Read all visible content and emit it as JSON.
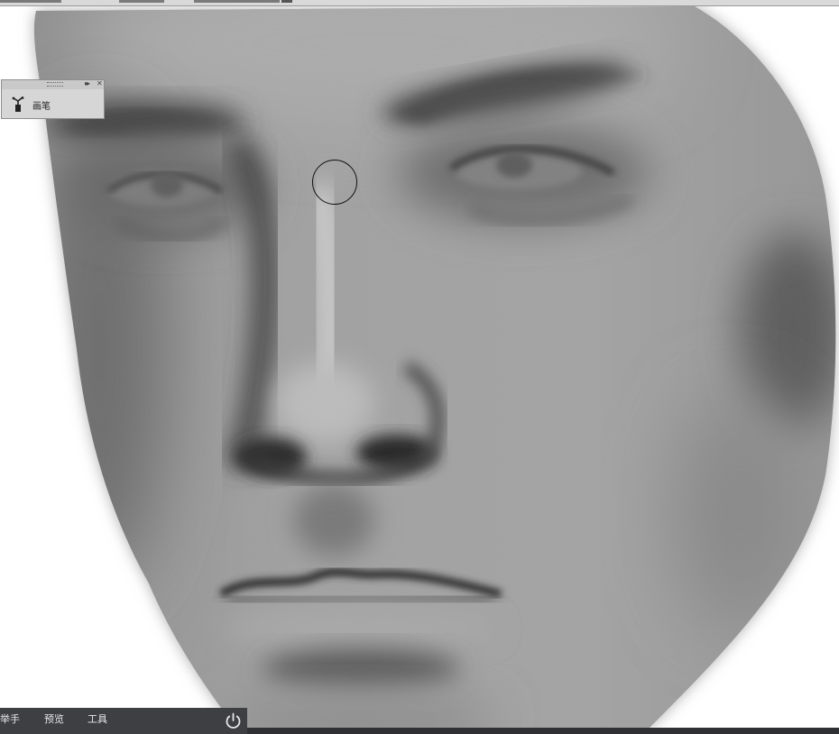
{
  "panel": {
    "tool_label": "画笔",
    "tool_icon": "brush-icon",
    "collapse_icon": "double-arrow-icon",
    "close_icon": "close-icon"
  },
  "bottom_bar": {
    "items": [
      {
        "label": "举手"
      },
      {
        "label": "预览"
      },
      {
        "label": "工具"
      }
    ],
    "power_icon": "power-icon"
  },
  "canvas": {
    "subject": "grayscale digital painting of a face",
    "brush_cursor": "circle-brush-cursor"
  },
  "colors": {
    "panel_bg": "#d6d6d6",
    "bottom_bar_bg": "#3d3f42",
    "bottom_bar_text": "#e8e8e8",
    "canvas_bg": "#ffffff",
    "skin_base": "#9a9a9a"
  }
}
